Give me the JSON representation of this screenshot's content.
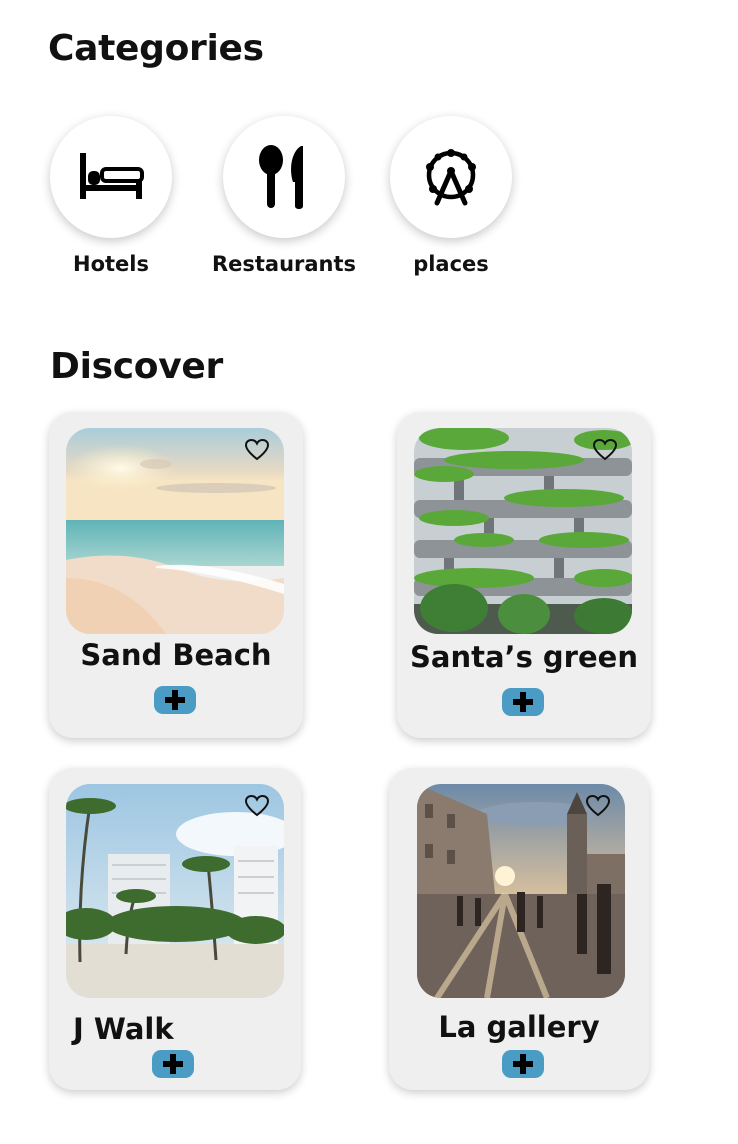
{
  "categories": {
    "heading": "Categories",
    "items": [
      {
        "label": "Hotels",
        "icon": "bed-icon"
      },
      {
        "label": "Restaurants",
        "icon": "cutlery-icon"
      },
      {
        "label": "places",
        "icon": "ferris-wheel-icon"
      }
    ]
  },
  "discover": {
    "heading": "Discover",
    "cards": [
      {
        "title": "Sand Beach",
        "image": "beach-sunset-photo",
        "favorite": false
      },
      {
        "title": "Santa’s green",
        "image": "green-building-photo",
        "favorite": false
      },
      {
        "title": "J Walk",
        "image": "palm-beach-photo",
        "favorite": false
      },
      {
        "title": "La gallery",
        "image": "old-town-square-photo",
        "favorite": false
      }
    ]
  },
  "colors": {
    "add_button": "#4a9cc4",
    "card_background": "#efefef",
    "text": "#111111"
  }
}
